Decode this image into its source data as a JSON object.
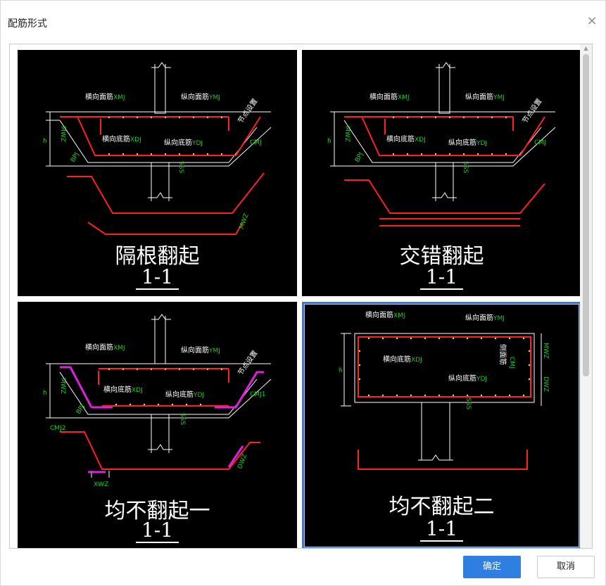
{
  "dialog": {
    "title": "配筋形式",
    "close_symbol": "×"
  },
  "options": [
    {
      "caption": "隔根翻起",
      "section": "1-1",
      "labels": {
        "top_transverse": "横向面筋",
        "top_transverse_code": "XMJ",
        "top_longitudinal": "纵向面筋",
        "top_longitudinal_code": "YMJ",
        "bottom_transverse": "横向底筋",
        "bottom_transverse_code": "XDJ",
        "bottom_longitudinal": "纵向底筋",
        "bottom_longitudinal_code": "YDJ",
        "node": "节点设置",
        "cmj": "CMJ",
        "h": "h",
        "wz": "MWZ",
        "bp": "BPJ",
        "ss": "SSS",
        "wz2": "MWZ"
      }
    },
    {
      "caption": "交错翻起",
      "section": "1-1",
      "labels": {
        "top_transverse": "横向面筋",
        "top_transverse_code": "XMJ",
        "top_longitudinal": "纵向面筋",
        "top_longitudinal_code": "YMJ",
        "bottom_transverse": "横向底筋",
        "bottom_transverse_code": "XDJ",
        "bottom_longitudinal": "纵向底筋",
        "bottom_longitudinal_code": "YDJ",
        "node": "节点设置",
        "cmj": "CMJ",
        "h": "h",
        "wz": "MWZ",
        "bp": "BPJ",
        "ss": "SSS"
      }
    },
    {
      "caption": "均不翻起一",
      "section": "1-1",
      "labels": {
        "top_transverse": "横向面筋",
        "top_transverse_code": "XMJ",
        "top_longitudinal": "纵向面筋",
        "top_longitudinal_code": "YMJ",
        "bottom_transverse": "横向底筋",
        "bottom_transverse_code": "XDJ",
        "bottom_longitudinal": "纵向底筋",
        "bottom_longitudinal_code": "YDJ",
        "node": "节点设置",
        "cmj1": "CMJ1",
        "cmj2": "CMJ2",
        "h": "h",
        "wz": "MWZ",
        "bp": "BPJ",
        "ss": "SSS",
        "xwz": "XWZ",
        "wz2": "DWZ"
      }
    },
    {
      "caption": "均不翻起二",
      "section": "1-1",
      "labels": {
        "top_transverse": "横向面筋",
        "top_transverse_code": "XMJ",
        "top_longitudinal": "纵向面筋",
        "top_longitudinal_code": "YMJ",
        "bottom_transverse": "横向底筋",
        "bottom_transverse_code": "XDJ",
        "bottom_longitudinal": "纵向底筋",
        "bottom_longitudinal_code": "YDJ",
        "side": "侧面筋",
        "cmj": "CMJ",
        "h": "h",
        "mwz": "MWZ",
        "dwz": "DWZ",
        "ss": "SSS"
      }
    }
  ],
  "selected_index": 3,
  "buttons": {
    "ok": "确定",
    "cancel": "取消"
  },
  "colors": {
    "accent": "#2f7fe0",
    "rebar": "#ff0000",
    "dimension": "#1ed01e",
    "alt_rebar": "#e020e0"
  }
}
